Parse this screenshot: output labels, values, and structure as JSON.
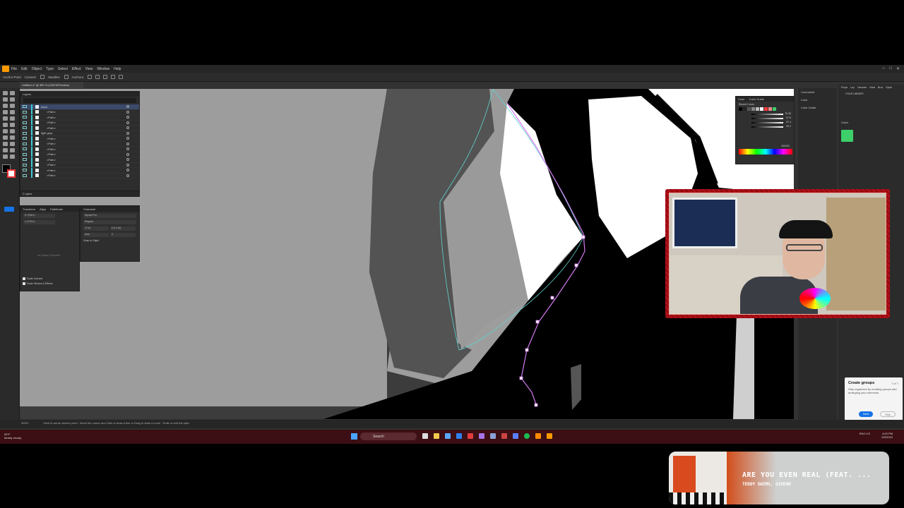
{
  "app": {
    "menu": [
      "File",
      "Edit",
      "Object",
      "Type",
      "Select",
      "Effect",
      "View",
      "Window",
      "Help"
    ],
    "control_bar": [
      "Anchor Point",
      "Convert:",
      "Handles:",
      "Anchors:"
    ],
    "doc_tab": "Untitled-1* @ 300 % (CMYK/Preview)"
  },
  "layers_panel": {
    "tabs": [
      "Layers"
    ],
    "rows": [
      {
        "label": "black",
        "selected": true
      },
      {
        "label": "<Path>"
      },
      {
        "label": "<Path>"
      },
      {
        "label": "<Path>"
      },
      {
        "label": "<Path>"
      },
      {
        "label": "light gray"
      },
      {
        "label": "<Path>"
      },
      {
        "label": "<Path>"
      },
      {
        "label": "<Path>"
      },
      {
        "label": "<Path>"
      },
      {
        "label": "<Path>"
      },
      {
        "label": "<Path>"
      },
      {
        "label": "<Path>"
      },
      {
        "label": "<Path>"
      }
    ],
    "footer": "2 Layers"
  },
  "transform_panel": {
    "tabs": [
      "Transform",
      "Align",
      "Pathfinder"
    ],
    "x_value": "6.7936 in",
    "y_value": "1.4793 in",
    "placeholder": "No Shape Properties",
    "options": [
      "Scale Corners",
      "Scale Strokes & Effects"
    ]
  },
  "character_panel": {
    "tab": "Character",
    "font": "Myriad Pro",
    "style": "Regular",
    "size": "12 pt",
    "leading": "(14.4 pt)",
    "tracking": "Auto",
    "kerning": "0",
    "snap": "Snap to Glyph"
  },
  "color_panel": {
    "tabs": [
      "Color",
      "Color Guide"
    ],
    "recent_label": "Recent Colors",
    "values": [
      "76.35",
      "67.9",
      "67.4",
      "90.2"
    ],
    "swatches": [
      "#000000",
      "#222222",
      "#555555",
      "#888888",
      "#bbbbbb",
      "#ffffff",
      "#ff3b3b",
      "#ff8a8a",
      "#3ccf6a"
    ],
    "hex": "000000"
  },
  "comments_panel": {
    "items": [
      "Comments",
      "Color",
      "Color Guide"
    ]
  },
  "libraries_panel": {
    "tabs": [
      "Props",
      "Lay",
      "Libraries",
      "Swat",
      "Brus",
      "Symb"
    ],
    "title": "YOUR LIBRARY",
    "section": "Colors",
    "accent": "#3ccf6a"
  },
  "create_groups_popup": {
    "title": "Create groups",
    "counter": "7 of 7",
    "body": "Stay organized by creating groups and arranging your elements.",
    "next": "Next",
    "skip": "Skip"
  },
  "status_bar": {
    "zoom": "300%",
    "hint": "Click to set an anchor point · Move the cursor and Click to draw a line or Drag to draw a curve · Enter to exit the path"
  },
  "taskbar": {
    "weather_temp": "59°F",
    "weather_desc": "Mostly cloudy",
    "search": "Search",
    "lang": "ENG US",
    "time": "4:00 PM",
    "date": "5/3/2024"
  },
  "now_playing": {
    "title": "ARE YOU EVEN REAL (FEAT. ...",
    "artist": "TEDDY SWIMS, GIVEON"
  }
}
